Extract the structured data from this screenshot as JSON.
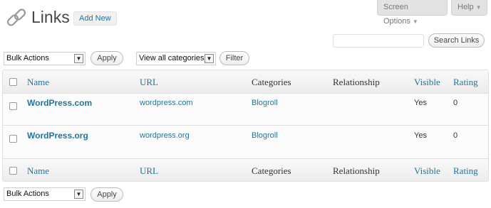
{
  "header": {
    "title": "Links",
    "add_new_label": "Add New",
    "screen_options_label": "Screen Options",
    "help_label": "Help"
  },
  "search": {
    "input_value": "",
    "button_label": "Search Links"
  },
  "top_actions": {
    "bulk_actions": "Bulk Actions",
    "apply_label": "Apply",
    "category_filter": "View all categories",
    "filter_label": "Filter"
  },
  "bottom_actions": {
    "bulk_actions": "Bulk Actions",
    "apply_label": "Apply"
  },
  "table": {
    "columns": {
      "name": "Name",
      "url": "URL",
      "categories": "Categories",
      "relationship": "Relationship",
      "visible": "Visible",
      "rating": "Rating"
    },
    "rows": [
      {
        "name": "WordPress.com",
        "url": "wordpress.com",
        "category": "Blogroll",
        "relationship": "",
        "visible": "Yes",
        "rating": "0"
      },
      {
        "name": "WordPress.org",
        "url": "wordpress.org",
        "category": "Blogroll",
        "relationship": "",
        "visible": "Yes",
        "rating": "0"
      }
    ]
  },
  "colors": {
    "link": "#21759b",
    "header_bg": "#ececec",
    "border": "#dfdfdf"
  },
  "icons": [
    "links-icon",
    "dropdown-arrow-icon",
    "checkbox-icon"
  ]
}
